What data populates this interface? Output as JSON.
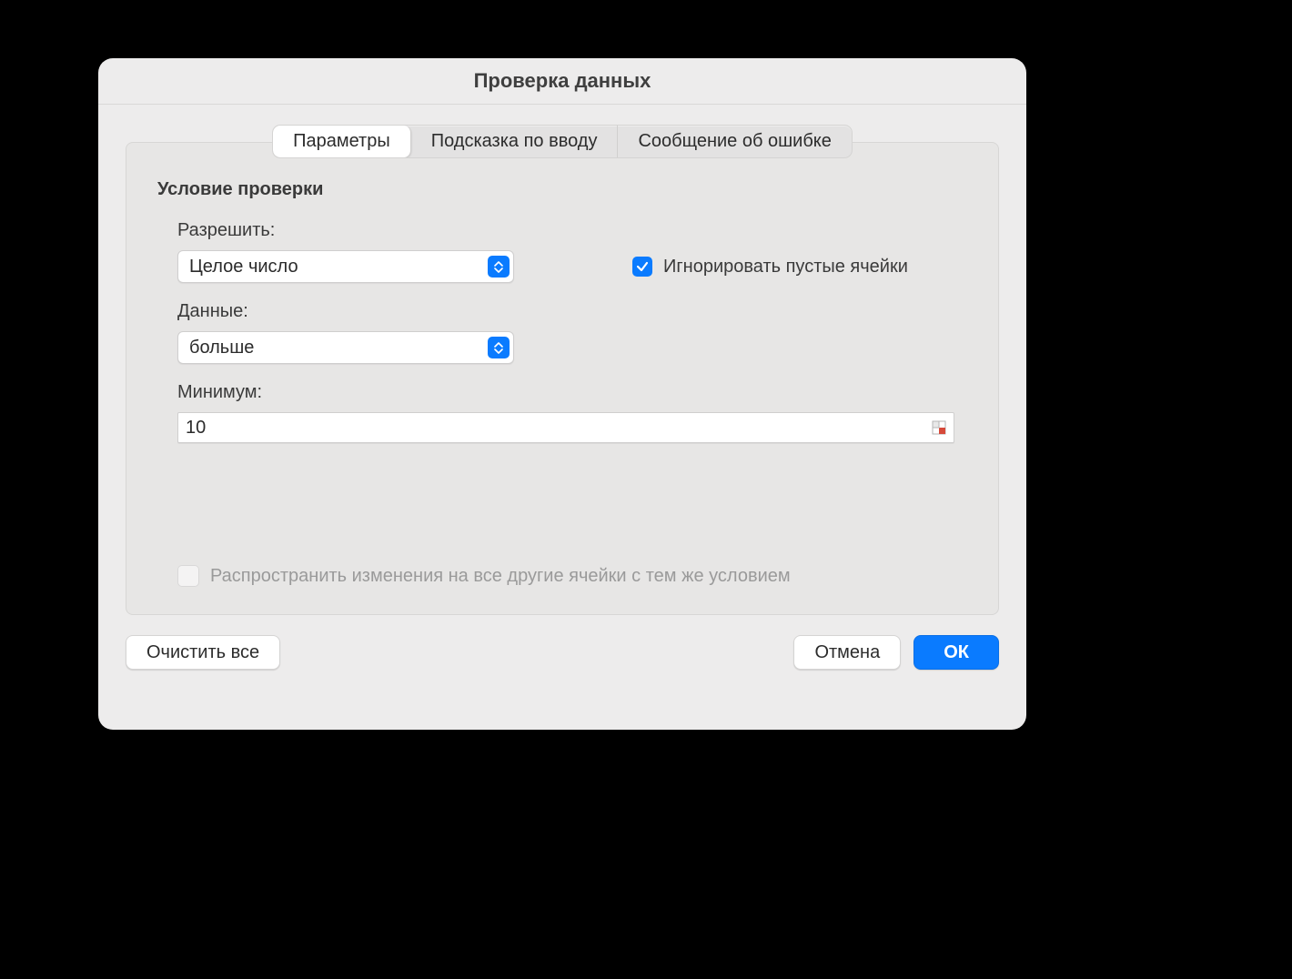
{
  "dialog": {
    "title": "Проверка данных",
    "tabs": {
      "params": "Параметры",
      "hint": "Подсказка по вводу",
      "error": "Сообщение об ошибке",
      "active": "params"
    }
  },
  "panel": {
    "section_title": "Условие проверки",
    "allow_label": "Разрешить:",
    "allow_value": "Целое число",
    "ignore_blank_label": "Игнорировать пустые ячейки",
    "ignore_blank_checked": true,
    "data_label": "Данные:",
    "data_value": "больше",
    "min_label": "Минимум:",
    "min_value": "10",
    "propagate_label": "Распространить изменения на все другие ячейки с тем же условием",
    "propagate_checked": false,
    "propagate_enabled": false
  },
  "buttons": {
    "clear_all": "Очистить все",
    "cancel": "Отмена",
    "ok": "ОК"
  }
}
